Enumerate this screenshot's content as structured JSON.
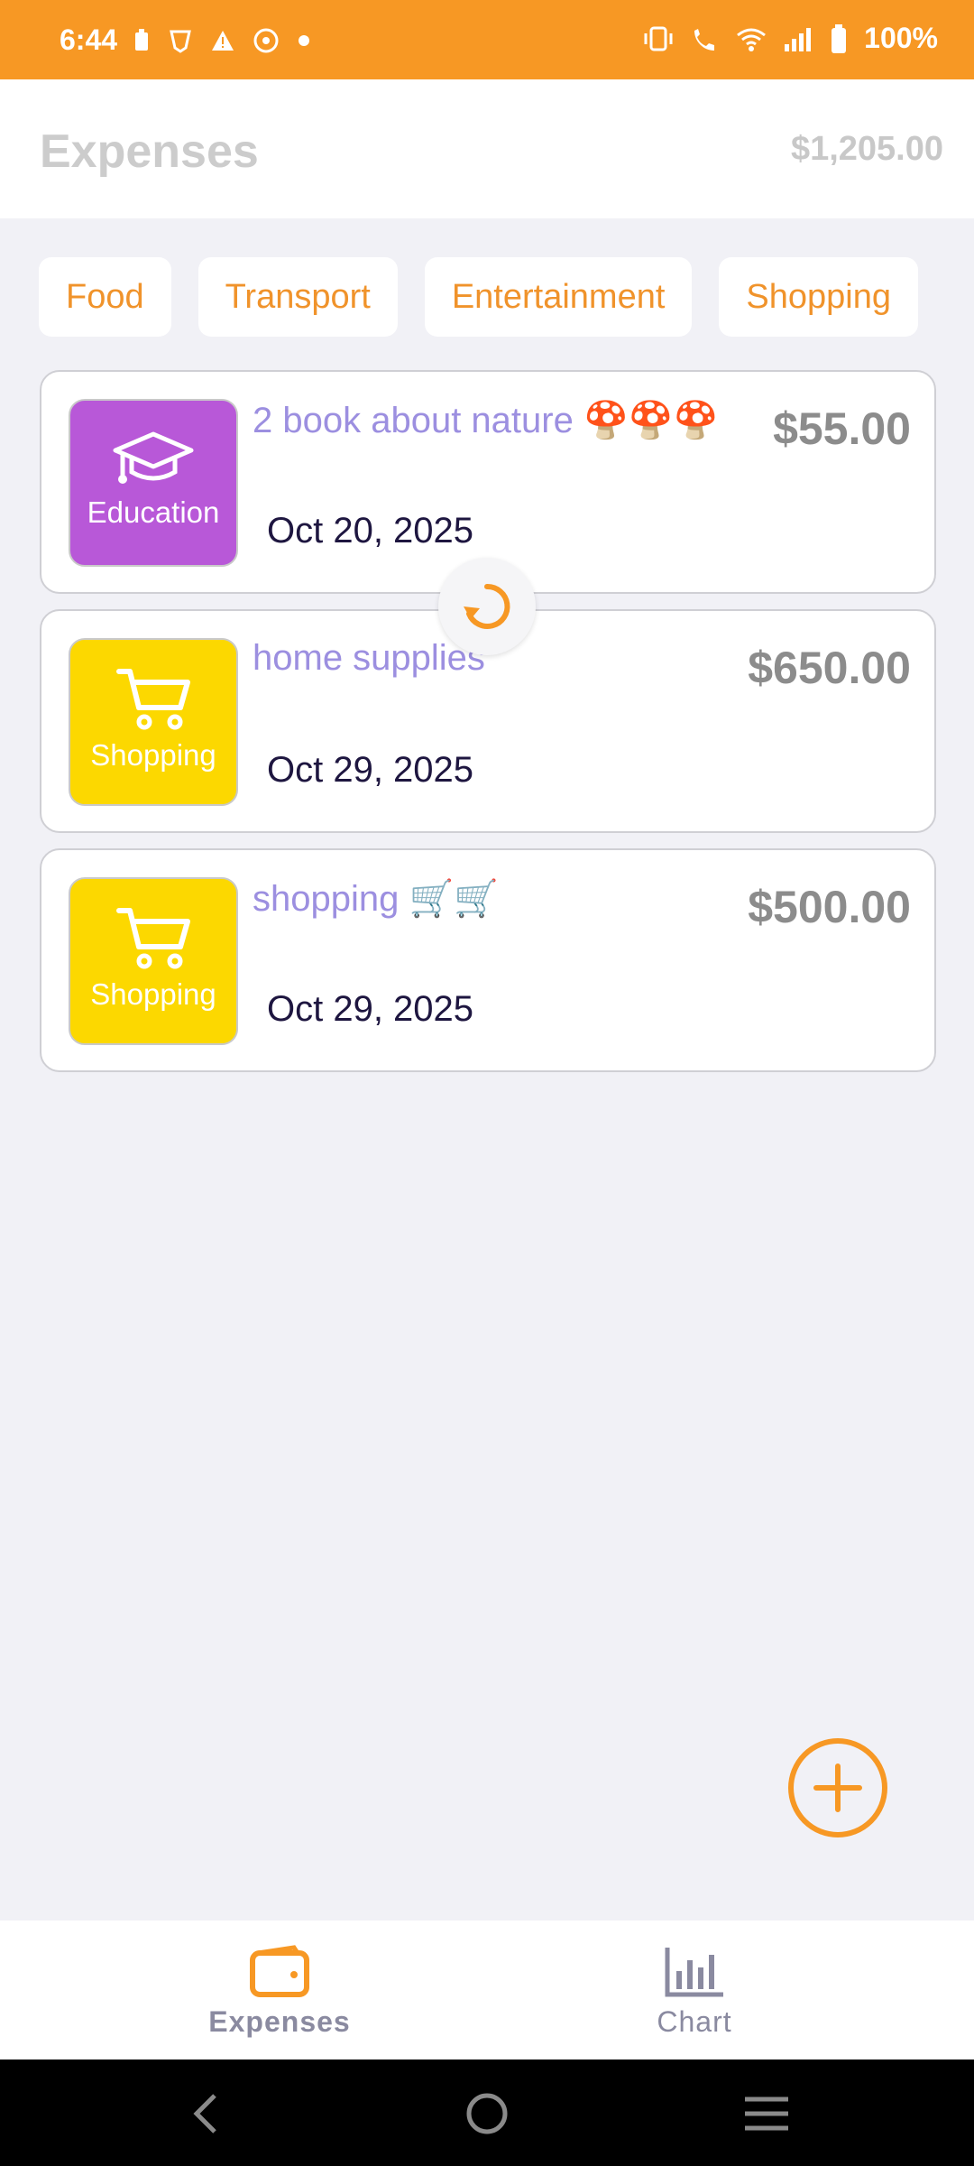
{
  "status": {
    "time": "6:44",
    "battery": "100%"
  },
  "header": {
    "title": "Expenses",
    "total": "$1,205.00"
  },
  "chips": [
    "Food",
    "Transport",
    "Entertainment",
    "Shopping"
  ],
  "expenses": [
    {
      "title": "2 book about nature 🍄🍄🍄",
      "date": "Oct 20, 2025",
      "amount": "$55.00",
      "category": "Education",
      "color": "#b858d8",
      "icon": "graduation-cap-icon"
    },
    {
      "title": "home supplies",
      "date": "Oct 29, 2025",
      "amount": "$650.00",
      "category": "Shopping",
      "color": "#fcd800",
      "icon": "shopping-cart-icon"
    },
    {
      "title": "shopping 🛒🛒",
      "date": "Oct 29, 2025",
      "amount": "$500.00",
      "category": "Shopping",
      "color": "#fcd800",
      "icon": "shopping-cart-icon"
    }
  ],
  "tabs": [
    {
      "label": "Expenses",
      "active": true
    },
    {
      "label": "Chart",
      "active": false
    }
  ],
  "colors": {
    "accent": "#f79824",
    "title_purple": "#9c8fe0"
  }
}
